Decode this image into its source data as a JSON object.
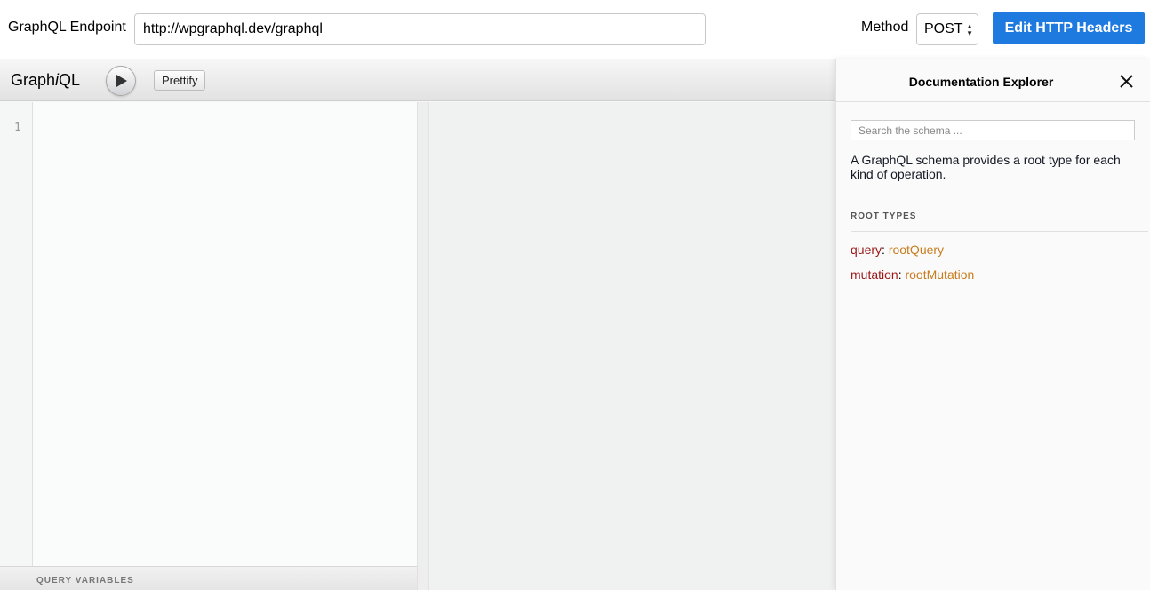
{
  "top": {
    "endpoint_label": "GraphQL Endpoint",
    "endpoint_value": "http://wpgraphql.dev/graphql",
    "method_label": "Method",
    "method_value": "POST",
    "edit_headers_label": "Edit HTTP Headers"
  },
  "graphiql": {
    "logo_prefix": "Graph",
    "logo_i": "i",
    "logo_suffix": "QL",
    "prettify_label": "Prettify",
    "line_number": "1",
    "variables_title": "QUERY VARIABLES"
  },
  "docs": {
    "title": "Documentation Explorer",
    "search_placeholder": "Search the schema ...",
    "description": "A GraphQL schema provides a root type for each kind of operation.",
    "root_types_title": "ROOT TYPES",
    "root_types": [
      {
        "field": "query",
        "type": "rootQuery"
      },
      {
        "field": "mutation",
        "type": "rootMutation"
      }
    ]
  },
  "colors": {
    "accent": "#1f7ae0",
    "field": "#9b1919",
    "type": "#c77d1e"
  },
  "icons": {
    "run": "play-icon",
    "close": "close-icon",
    "select": "chevron-updown-icon"
  }
}
